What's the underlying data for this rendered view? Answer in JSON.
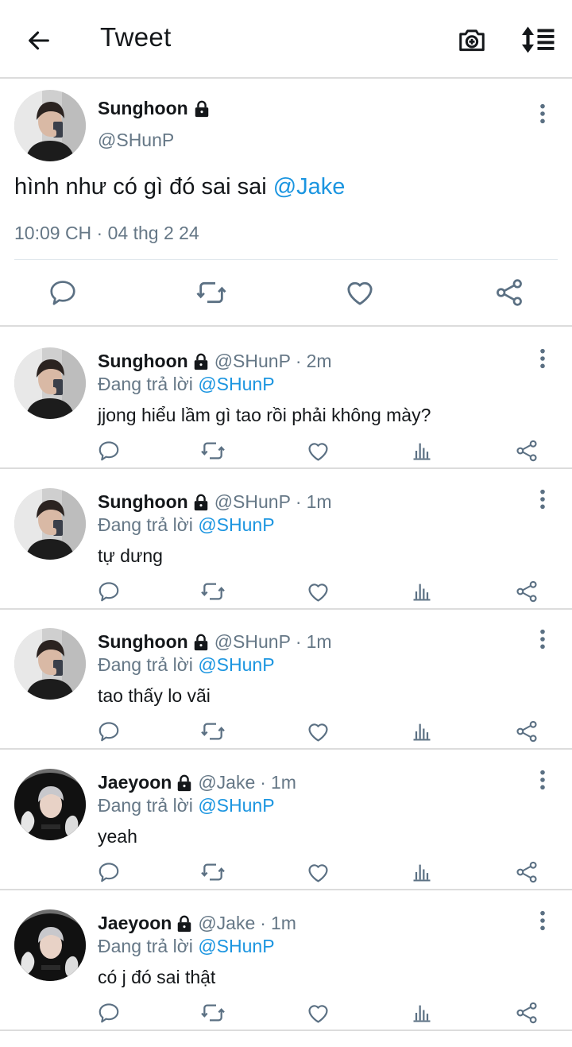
{
  "header": {
    "title": "Tweet",
    "icons": [
      "back-arrow-icon",
      "camera-plus-icon",
      "sort-icon"
    ]
  },
  "main_tweet": {
    "name": "Sunghoon",
    "handle": "@SHunP",
    "text_plain": "hình như có gì đó sai sai ",
    "mention": "@Jake",
    "timestamp": "10:09 CH · 04 thg 2 24",
    "actions": [
      "reply-icon",
      "retweet-icon",
      "like-icon",
      "share-icon"
    ]
  },
  "replies": [
    {
      "name": "Sunghoon",
      "handle": "@SHunP",
      "time": "2m",
      "replying_prefix": "Đang trả lời ",
      "replying_to": "@SHunP",
      "text": "jjong hiểu lầm gì tao rồi phải không mày?"
    },
    {
      "name": "Sunghoon",
      "handle": "@SHunP",
      "time": "1m",
      "replying_prefix": "Đang trả lời ",
      "replying_to": "@SHunP",
      "text": "tự dưng"
    },
    {
      "name": "Sunghoon",
      "handle": "@SHunP",
      "time": "1m",
      "replying_prefix": "Đang trả lời ",
      "replying_to": "@SHunP",
      "text": "tao thấy lo vãi"
    },
    {
      "name": "Jaeyoon",
      "handle": "@Jake",
      "time": "1m",
      "replying_prefix": "Đang trả lời ",
      "replying_to": "@SHunP",
      "text": "yeah"
    },
    {
      "name": "Jaeyoon",
      "handle": "@Jake",
      "time": "1m",
      "replying_prefix": "Đang trả lời ",
      "replying_to": "@SHunP",
      "text": "có j đó sai thật"
    }
  ],
  "reply_actions": [
    "reply-icon",
    "retweet-icon",
    "like-icon",
    "analytics-icon",
    "share-icon"
  ],
  "colors": {
    "text": "#14171a",
    "secondary": "#657786",
    "mention": "#1b95e0",
    "icon": "#5b7083",
    "divider": "#dcdcdc"
  }
}
